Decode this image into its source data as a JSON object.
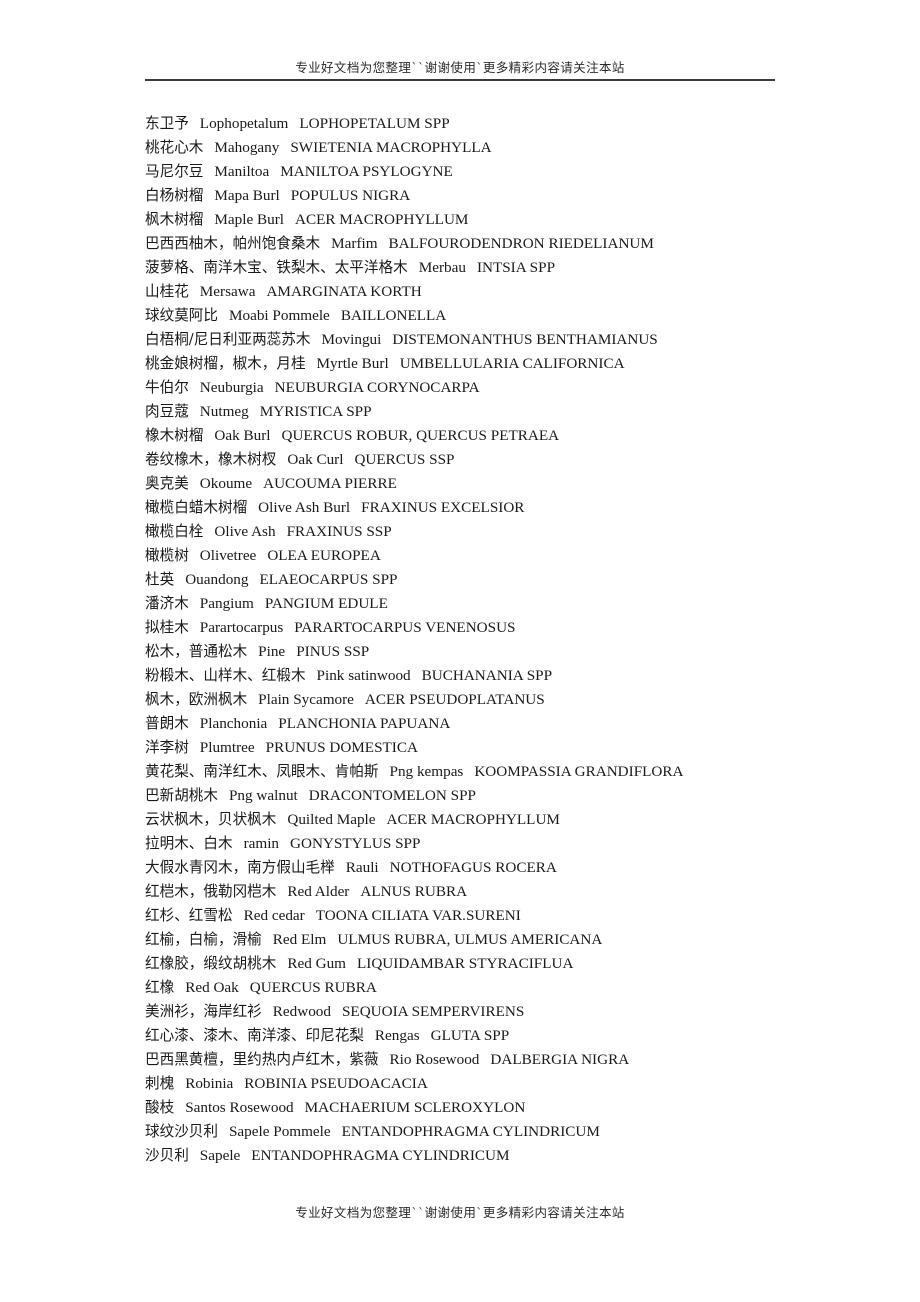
{
  "header": {
    "watermark": "专业好文档为您整理``谢谢使用`更多精彩内容请关注本站"
  },
  "footer": {
    "watermark": "专业好文档为您整理``谢谢使用`更多精彩内容请关注本站"
  },
  "entries": [
    {
      "cn": "东卫予",
      "en": "Lophopetalum",
      "sci": "LOPHOPETALUM SPP"
    },
    {
      "cn": "桃花心木",
      "en": "Mahogany",
      "sci": "SWIETENIA MACROPHYLLA"
    },
    {
      "cn": "马尼尔豆",
      "en": "Maniltoa",
      "sci": "MANILTOA PSYLOGYNE"
    },
    {
      "cn": "白杨树榴",
      "en": "Mapa Burl",
      "sci": "POPULUS NIGRA"
    },
    {
      "cn": "枫木树榴",
      "en": "Maple Burl",
      "sci": "ACER MACROPHYLLUM"
    },
    {
      "cn": "巴西西柚木，帕州饱食桑木",
      "en": "Marfim",
      "sci": "BALFOURODENDRON RIEDELIANUM"
    },
    {
      "cn": "菠萝格、南洋木宝、铁梨木、太平洋格木",
      "en": "Merbau",
      "sci": "INTSIA SPP"
    },
    {
      "cn": "山桂花",
      "en": "Mersawa",
      "sci": "AMARGINATA KORTH"
    },
    {
      "cn": "球纹莫阿比",
      "en": "Moabi Pommele",
      "sci": "BAILLONELLA"
    },
    {
      "cn": "白梧桐/尼日利亚两蕊苏木",
      "en": "Movingui",
      "sci": "DISTEMONANTHUS BENTHAMIANUS"
    },
    {
      "cn": "桃金娘树榴，椒木，月桂",
      "en": "Myrtle Burl",
      "sci": "UMBELLULARIA CALIFORNICA"
    },
    {
      "cn": "牛伯尔",
      "en": "Neuburgia",
      "sci": "NEUBURGIA CORYNOCARPA"
    },
    {
      "cn": "肉豆蔻",
      "en": "Nutmeg",
      "sci": "MYRISTICA SPP"
    },
    {
      "cn": "橡木树榴",
      "en": "Oak Burl",
      "sci": "QUERCUS ROBUR, QUERCUS PETRAEA"
    },
    {
      "cn": "卷纹橡木，橡木树杈",
      "en": "Oak Curl",
      "sci": "QUERCUS SSP"
    },
    {
      "cn": "奥克美",
      "en": "Okoume",
      "sci": "AUCOUMA PIERRE"
    },
    {
      "cn": "橄榄白蜡木树榴",
      "en": "Olive Ash Burl",
      "sci": "FRAXINUS EXCELSIOR"
    },
    {
      "cn": "橄榄白栓",
      "en": "Olive Ash",
      "sci": "FRAXINUS SSP"
    },
    {
      "cn": "橄榄树",
      "en": "Olivetree",
      "sci": "OLEA EUROPEA"
    },
    {
      "cn": "杜英",
      "en": "Ouandong",
      "sci": "ELAEOCARPUS SPP"
    },
    {
      "cn": "潘济木",
      "en": "Pangium",
      "sci": "PANGIUM EDULE"
    },
    {
      "cn": "拟桂木",
      "en": "Parartocarpus",
      "sci": "PARARTOCARPUS VENENOSUS"
    },
    {
      "cn": "松木，普通松木",
      "en": "Pine",
      "sci": "PINUS SSP"
    },
    {
      "cn": "粉椴木、山样木、红椴木",
      "en": "Pink satinwood",
      "sci": "BUCHANANIA SPP"
    },
    {
      "cn": "枫木，欧洲枫木",
      "en": "Plain Sycamore",
      "sci": "ACER PSEUDOPLATANUS"
    },
    {
      "cn": "普朗木",
      "en": "Planchonia",
      "sci": "PLANCHONIA PAPUANA"
    },
    {
      "cn": "洋李树",
      "en": "Plumtree",
      "sci": "PRUNUS DOMESTICA"
    },
    {
      "cn": "黄花梨、南洋红木、凤眼木、肯帕斯",
      "en": "Png kempas",
      "sci": "KOOMPASSIA GRANDIFLORA"
    },
    {
      "cn": "巴新胡桃木",
      "en": "Png walnut",
      "sci": "DRACONTOMELON SPP"
    },
    {
      "cn": "云状枫木，贝状枫木",
      "en": "Quilted Maple",
      "sci": "ACER MACROPHYLLUM"
    },
    {
      "cn": "拉明木、白木",
      "en": "ramin",
      "sci": "GONYSTYLUS SPP"
    },
    {
      "cn": "大假水青冈木，南方假山毛榉",
      "en": "Rauli",
      "sci": "NOTHOFAGUS ROCERA"
    },
    {
      "cn": "红桤木，俄勒冈桤木",
      "en": "Red Alder",
      "sci": "ALNUS RUBRA"
    },
    {
      "cn": "红杉、红雪松",
      "en": "Red cedar",
      "sci": "TOONA CILIATA VAR.SURENI"
    },
    {
      "cn": "红榆，白榆，滑榆",
      "en": "Red Elm",
      "sci": "ULMUS RUBRA, ULMUS AMERICANA"
    },
    {
      "cn": "红橡胶，缎纹胡桃木",
      "en": "Red Gum",
      "sci": "LIQUIDAMBAR STYRACIFLUA"
    },
    {
      "cn": "红橡",
      "en": "Red Oak",
      "sci": "QUERCUS RUBRA"
    },
    {
      "cn": "美洲衫，海岸红衫",
      "en": "Redwood",
      "sci": "SEQUOIA SEMPERVIRENS"
    },
    {
      "cn": "红心漆、漆木、南洋漆、印尼花梨",
      "en": "Rengas",
      "sci": "GLUTA SPP"
    },
    {
      "cn": "巴西黑黄檀，里约热内卢红木，紫薇",
      "en": "Rio Rosewood",
      "sci": "DALBERGIA NIGRA"
    },
    {
      "cn": "刺槐",
      "en": "Robinia",
      "sci": "ROBINIA PSEUDOACACIA"
    },
    {
      "cn": "酸枝",
      "en": "Santos Rosewood",
      "sci": "MACHAERIUM SCLEROXYLON"
    },
    {
      "cn": "球纹沙贝利",
      "en": "Sapele Pommele",
      "sci": "ENTANDOPHRAGMA CYLINDRICUM"
    },
    {
      "cn": "沙贝利",
      "en": "Sapele",
      "sci": "ENTANDOPHRAGMA CYLINDRICUM"
    }
  ]
}
